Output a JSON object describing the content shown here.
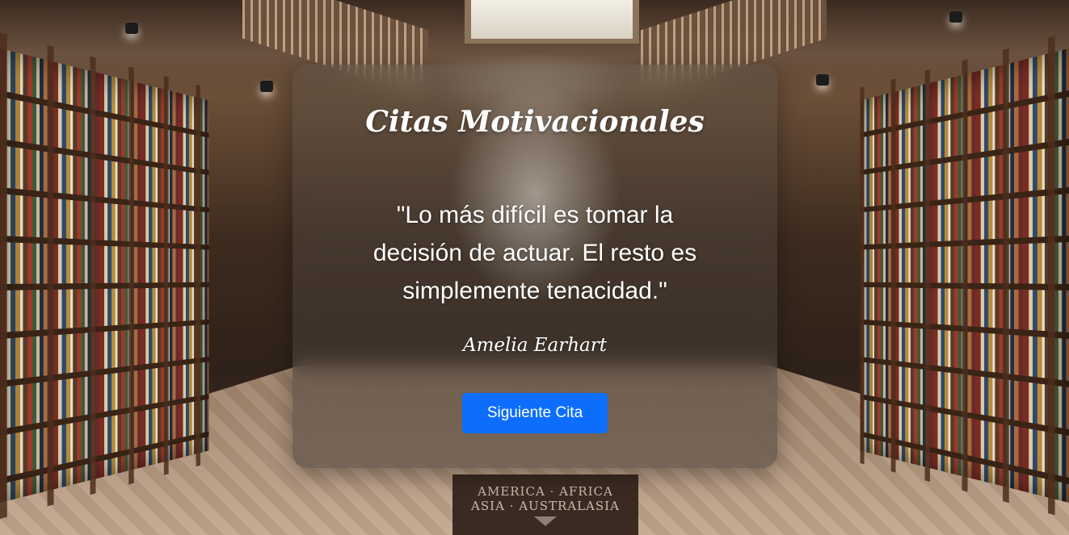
{
  "page": {
    "title": "Citas Motivacionales"
  },
  "quote": {
    "text": "\"Lo más difícil es tomar la decisión de actuar. El resto es simplemente tenacidad.\"",
    "author": "Amelia Earhart"
  },
  "actions": {
    "next_label": "Siguiente Cita"
  },
  "background": {
    "sign_line1": "AMERICA · AFRICA",
    "sign_line2": "ASIA · AUSTRALASIA"
  },
  "colors": {
    "button": "#0d6efd",
    "text": "#ffffff"
  }
}
